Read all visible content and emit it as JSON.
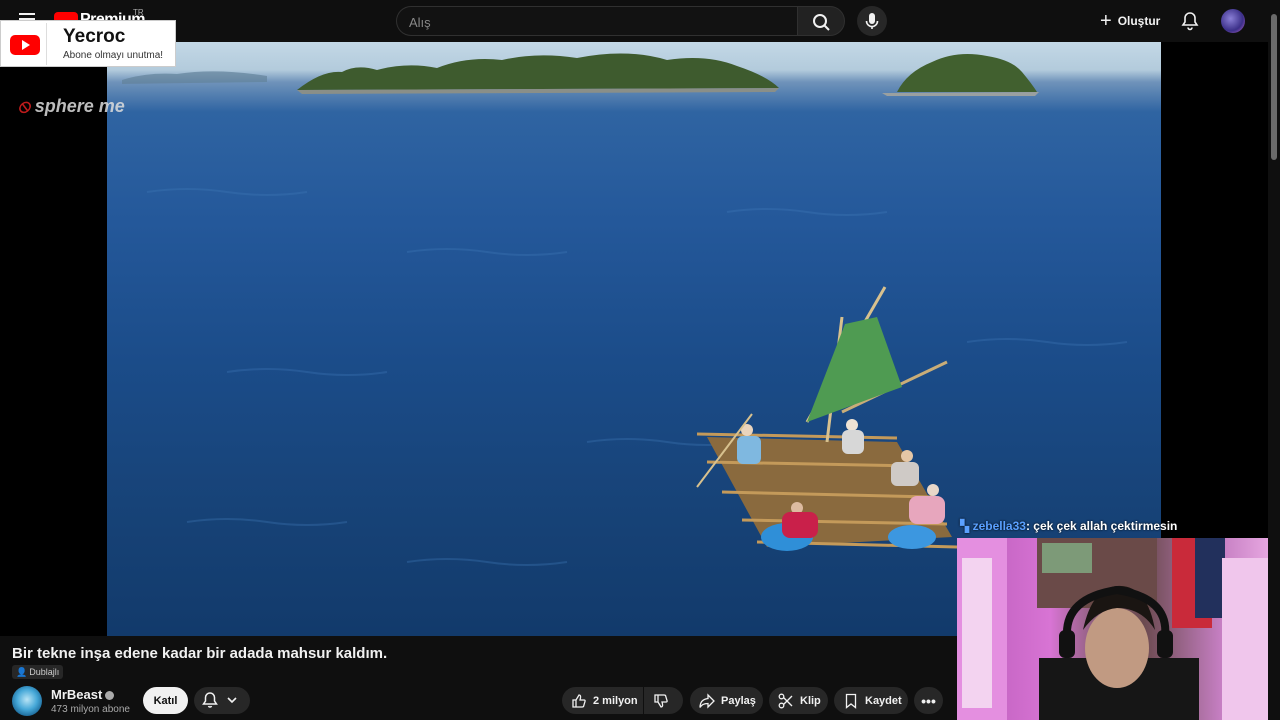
{
  "header": {
    "brand": "Premium",
    "brand_region": "TR",
    "search_placeholder": "Alış",
    "create_label": "Oluştur"
  },
  "popup": {
    "channel_name": "Yecroc",
    "tagline": "Abone olmayı unutma!"
  },
  "watermark": "sphere me",
  "chat": {
    "user": "zebella33",
    "message": ": çek çek allah çektirmesin"
  },
  "video": {
    "title": "Bir tekne inşa edene kadar bir adada mahsur kaldım.",
    "dub_badge": "Dublajlı"
  },
  "channel": {
    "name": "MrBeast",
    "subscribers": "473 milyon abone",
    "join_label": "Katıl"
  },
  "actions": {
    "likes": "2 milyon",
    "share": "Paylaş",
    "clip": "Klip",
    "save": "Kaydet",
    "more": "•••"
  },
  "colors": {
    "background": "#0f0f0f",
    "brand_red": "#ff0000",
    "button_bg": "#272727",
    "chat_user": "#5aa0ff"
  }
}
